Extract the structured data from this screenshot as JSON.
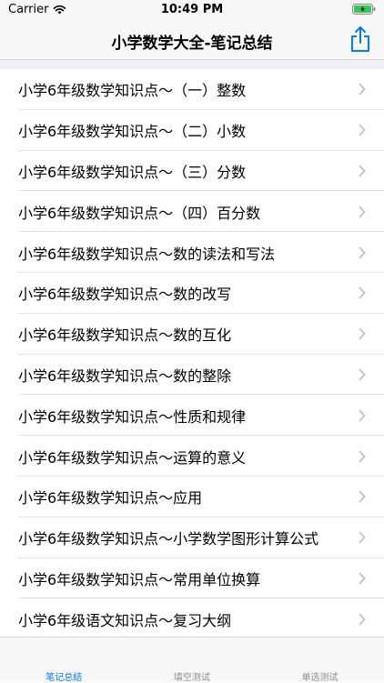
{
  "status_bar": {
    "carrier": "Carrier",
    "time": "10:49 PM"
  },
  "nav": {
    "title": "小学数学大全-笔记总结",
    "share_icon": "share-icon"
  },
  "colors": {
    "accent": "#007aff",
    "inactive_tab": "#8e8e93",
    "chevron": "#c4c4c7"
  },
  "list": {
    "items": [
      "小学6年级数学知识点～（一）整数",
      "小学6年级数学知识点～（二）小数",
      "小学6年级数学知识点～（三）分数",
      "小学6年级数学知识点～（四）百分数",
      "小学6年级数学知识点～数的读法和写法",
      "小学6年级数学知识点～数的改写",
      "小学6年级数学知识点～数的互化",
      "小学6年级数学知识点～数的整除",
      "小学6年级数学知识点～性质和规律",
      "小学6年级数学知识点～运算的意义",
      "小学6年级数学知识点～应用",
      "小学6年级数学知识点～小学数学图形计算公式",
      "小学6年级数学知识点～常用单位换算",
      "小学6年级语文知识点～复习大纲"
    ]
  },
  "tabs": [
    {
      "label": "笔记总结",
      "selected": true
    },
    {
      "label": "填空测试",
      "selected": false
    },
    {
      "label": "单选测试",
      "selected": false
    }
  ]
}
